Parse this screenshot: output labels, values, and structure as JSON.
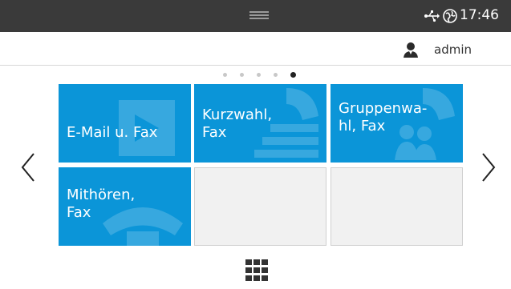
{
  "status": {
    "time": "17:46",
    "handle_icon": "handle-icon",
    "usb_icon": "usb-icon",
    "network_icon": "network-globe-icon"
  },
  "user": {
    "name": "admin",
    "icon": "user-icon"
  },
  "pagination": {
    "pages": 5,
    "current": 5
  },
  "tiles": [
    {
      "label": "E-Mail u. Fax",
      "icon": "email-fax-icon"
    },
    {
      "label": "Kurzwahl,\nFax",
      "icon": "speed-dial-fax-icon"
    },
    {
      "label": "Gruppenwa-\nhl, Fax",
      "icon": "group-dial-fax-icon"
    },
    {
      "label": "Mithören,\nFax",
      "icon": "on-hook-dial-fax-icon"
    },
    {
      "label": "",
      "icon": ""
    },
    {
      "label": "",
      "icon": ""
    }
  ],
  "navigation": {
    "prev_icon": "chevron-left-icon",
    "next_icon": "chevron-right-icon",
    "apps_icon": "apps-grid-icon"
  },
  "colors": {
    "statusbar": "#3a3a3a",
    "tile": "#0b95d8",
    "empty_tile": "#f1f1f1"
  }
}
